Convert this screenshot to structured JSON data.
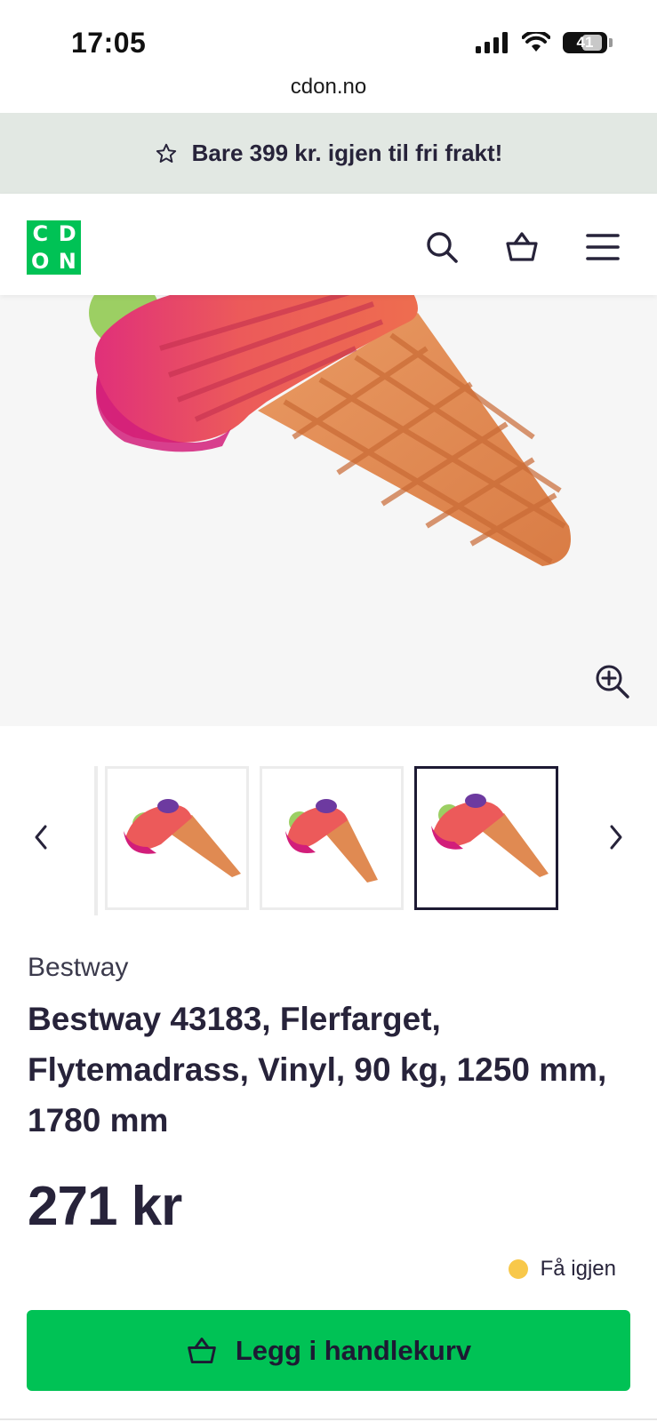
{
  "status_bar": {
    "time": "17:05",
    "battery": "41"
  },
  "browser": {
    "url": "cdon.no"
  },
  "promo": {
    "text": "Bare 399 kr. igjen til fri frakt!",
    "icon": "star-outline-icon"
  },
  "header": {
    "logo_letters": [
      "C",
      "D",
      "O",
      "N"
    ],
    "icons": [
      "search-icon",
      "basket-icon",
      "menu-icon"
    ],
    "brand_color": "#00c255"
  },
  "gallery": {
    "thumbnail_count": 3,
    "active_thumbnail": 3
  },
  "product": {
    "brand": "Bestway",
    "title": "Bestway 43183, Flerfarget, Flytemadrass, Vinyl, 90 kg, 1250 mm, 1780 mm",
    "price": "271 kr",
    "stock_label": "Få igjen",
    "stock_color": "#f8c84a"
  },
  "cta": {
    "label": "Legg i handlekurv"
  }
}
